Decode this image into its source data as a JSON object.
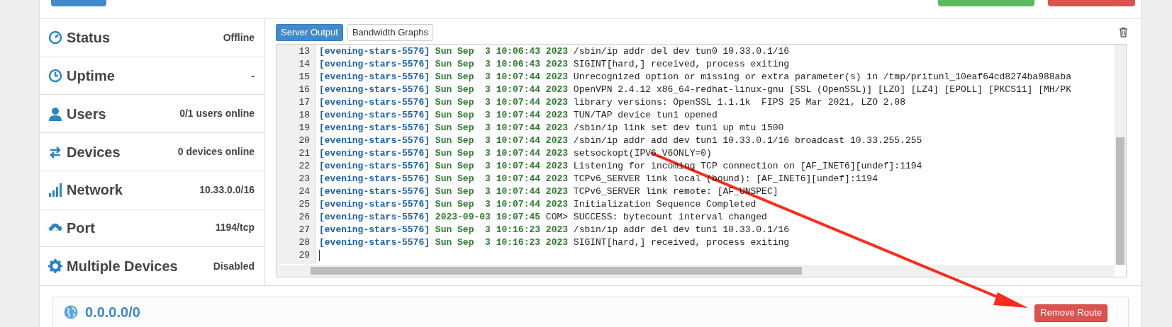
{
  "server_info": [
    {
      "kind": "status",
      "label": "Status",
      "value": "Offline"
    },
    {
      "kind": "uptime",
      "label": "Uptime",
      "value": "-"
    },
    {
      "kind": "users",
      "label": "Users",
      "value": "0/1 users online"
    },
    {
      "kind": "devices",
      "label": "Devices",
      "value": "0 devices online"
    },
    {
      "kind": "network",
      "label": "Network",
      "value": "10.33.0.0/16"
    },
    {
      "kind": "port",
      "label": "Port",
      "value": "1194/tcp"
    },
    {
      "kind": "multi",
      "label": "Multiple Devices",
      "value": "Disabled"
    }
  ],
  "tabs": [
    {
      "label": "Server Output",
      "selected": true
    },
    {
      "label": "Bandwidth Graphs",
      "selected": false
    }
  ],
  "log_lines": [
    {
      "number": "13",
      "source": "[evening-stars-5576]",
      "time": "Sun Sep  3 10:06:43 2023",
      "message": "/sbin/ip addr del dev tun0 10.33.0.1/16"
    },
    {
      "number": "14",
      "source": "[evening-stars-5576]",
      "time": "Sun Sep  3 10:06:43 2023",
      "message": "SIGINT[hard,] received, process exiting"
    },
    {
      "number": "15",
      "source": "[evening-stars-5576]",
      "time": "Sun Sep  3 10:07:44 2023",
      "message": "Unrecognized option or missing or extra parameter(s) in /tmp/pritunl_10eaf64cd8274ba988aba"
    },
    {
      "number": "16",
      "source": "[evening-stars-5576]",
      "time": "Sun Sep  3 10:07:44 2023",
      "message": "OpenVPN 2.4.12 x86_64-redhat-linux-gnu [SSL (OpenSSL)] [LZO] [LZ4] [EPOLL] [PKCS11] [MH/PK"
    },
    {
      "number": "17",
      "source": "[evening-stars-5576]",
      "time": "Sun Sep  3 10:07:44 2023",
      "message": "library versions: OpenSSL 1.1.1k  FIPS 25 Mar 2021, LZO 2.08"
    },
    {
      "number": "18",
      "source": "[evening-stars-5576]",
      "time": "Sun Sep  3 10:07:44 2023",
      "message": "TUN/TAP device tun1 opened"
    },
    {
      "number": "19",
      "source": "[evening-stars-5576]",
      "time": "Sun Sep  3 10:07:44 2023",
      "message": "/sbin/ip link set dev tun1 up mtu 1500"
    },
    {
      "number": "20",
      "source": "[evening-stars-5576]",
      "time": "Sun Sep  3 10:07:44 2023",
      "message": "/sbin/ip addr add dev tun1 10.33.0.1/16 broadcast 10.33.255.255"
    },
    {
      "number": "21",
      "source": "[evening-stars-5576]",
      "time": "Sun Sep  3 10:07:44 2023",
      "message": "setsockopt(IPV6_V6ONLY=0)"
    },
    {
      "number": "22",
      "source": "[evening-stars-5576]",
      "time": "Sun Sep  3 10:07:44 2023",
      "message": "Listening for incoming TCP connection on [AF_INET6][undef]:1194"
    },
    {
      "number": "23",
      "source": "[evening-stars-5576]",
      "time": "Sun Sep  3 10:07:44 2023",
      "message": "TCPv6_SERVER link local (bound): [AF_INET6][undef]:1194"
    },
    {
      "number": "24",
      "source": "[evening-stars-5576]",
      "time": "Sun Sep  3 10:07:44 2023",
      "message": "TCPv6_SERVER link remote: [AF_UNSPEC]"
    },
    {
      "number": "25",
      "source": "[evening-stars-5576]",
      "time": "Sun Sep  3 10:07:44 2023",
      "message": "Initialization Sequence Completed"
    },
    {
      "number": "26",
      "source": "[evening-stars-5576]",
      "time": "2023-09-03 10:07:45",
      "message": "COM> SUCCESS: bytecount interval changed"
    },
    {
      "number": "27",
      "source": "[evening-stars-5576]",
      "time": "Sun Sep  3 10:16:23 2023",
      "message": "/sbin/ip addr del dev tun1 10.33.0.1/16"
    },
    {
      "number": "28",
      "source": "[evening-stars-5576]",
      "time": "Sun Sep  3 10:16:23 2023",
      "message": "SIGINT[hard,] received, process exiting"
    },
    {
      "number": "29"
    }
  ],
  "route": {
    "network": "0.0.0.0/0",
    "button": "Remove Route"
  }
}
